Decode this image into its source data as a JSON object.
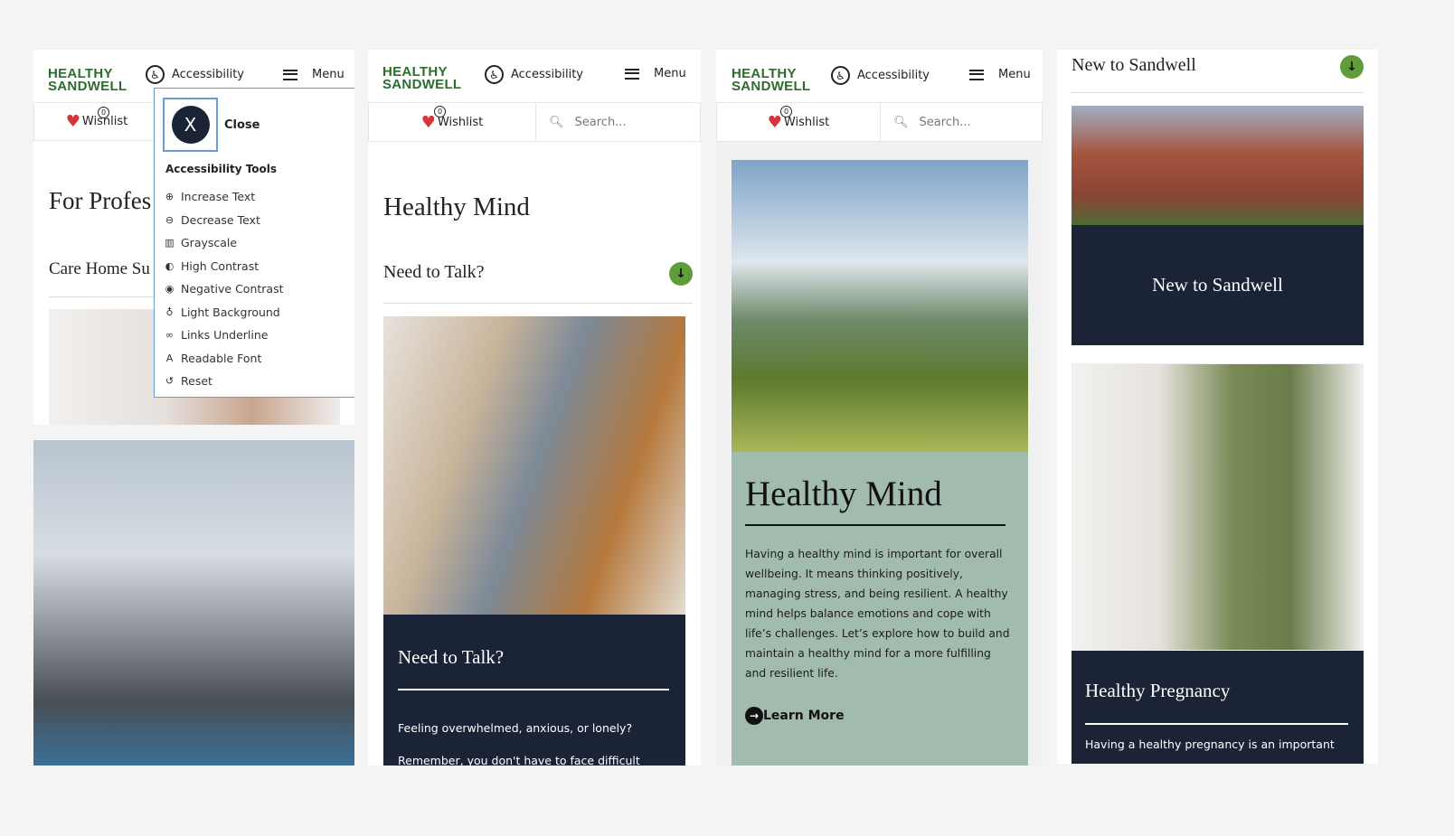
{
  "header": {
    "logo_line1": "HEALTHY",
    "logo_line2": "SANDWELL",
    "accessibility": "Accessibility",
    "menu": "Menu",
    "wishlist": "Wishlist",
    "wishlist_count": "0",
    "search_placeholder": "Search..."
  },
  "panel1": {
    "heading": "For Profes",
    "subheading": "Care Home Su",
    "a11y": {
      "close": "Close",
      "close_glyph": "X",
      "title": "Accessibility Tools",
      "tools": [
        {
          "icon": "zoom-in-icon",
          "glyph": "⊕",
          "label": "Increase Text"
        },
        {
          "icon": "zoom-out-icon",
          "glyph": "⊖",
          "label": "Decrease Text"
        },
        {
          "icon": "grayscale-icon",
          "glyph": "▥",
          "label": "Grayscale"
        },
        {
          "icon": "contrast-icon",
          "glyph": "◐",
          "label": "High Contrast"
        },
        {
          "icon": "eye-icon",
          "glyph": "◉",
          "label": "Negative Contrast"
        },
        {
          "icon": "lightbulb-icon",
          "glyph": "♁",
          "label": "Light Background"
        },
        {
          "icon": "link-icon",
          "glyph": "∞",
          "label": "Links Underline"
        },
        {
          "icon": "font-icon",
          "glyph": "A",
          "label": "Readable Font"
        },
        {
          "icon": "reset-icon",
          "glyph": "↺",
          "label": "Reset"
        }
      ]
    }
  },
  "panel2": {
    "title": "Healthy Mind",
    "accordion": "Need to Talk?",
    "card_title": "Need to Talk?",
    "card_text1": "Feeling overwhelmed, anxious, or lonely?",
    "card_text2": "Remember, you don't have to face difficult"
  },
  "panel3": {
    "title": "Healthy Mind",
    "body": "Having a healthy mind is important for overall wellbeing. It means thinking positively, managing stress, and being resilient. A healthy mind helps balance emotions and cope with life’s challenges. Let’s explore how to build and maintain a healthy mind for a more fulfilling and resilient life.",
    "cta": "Learn More"
  },
  "panel4": {
    "accordion": "New to Sandwell",
    "card1_title": "New to Sandwell",
    "card2_title": "Healthy Pregnancy",
    "card2_text": "Having a healthy pregnancy is an important"
  },
  "colors": {
    "navy": "#1b2336",
    "sage": "#a1bbae",
    "green": "#5f9d3a",
    "logo_green": "#2e6b2e",
    "heart": "#d8333a",
    "focus": "#6a9bd8"
  }
}
